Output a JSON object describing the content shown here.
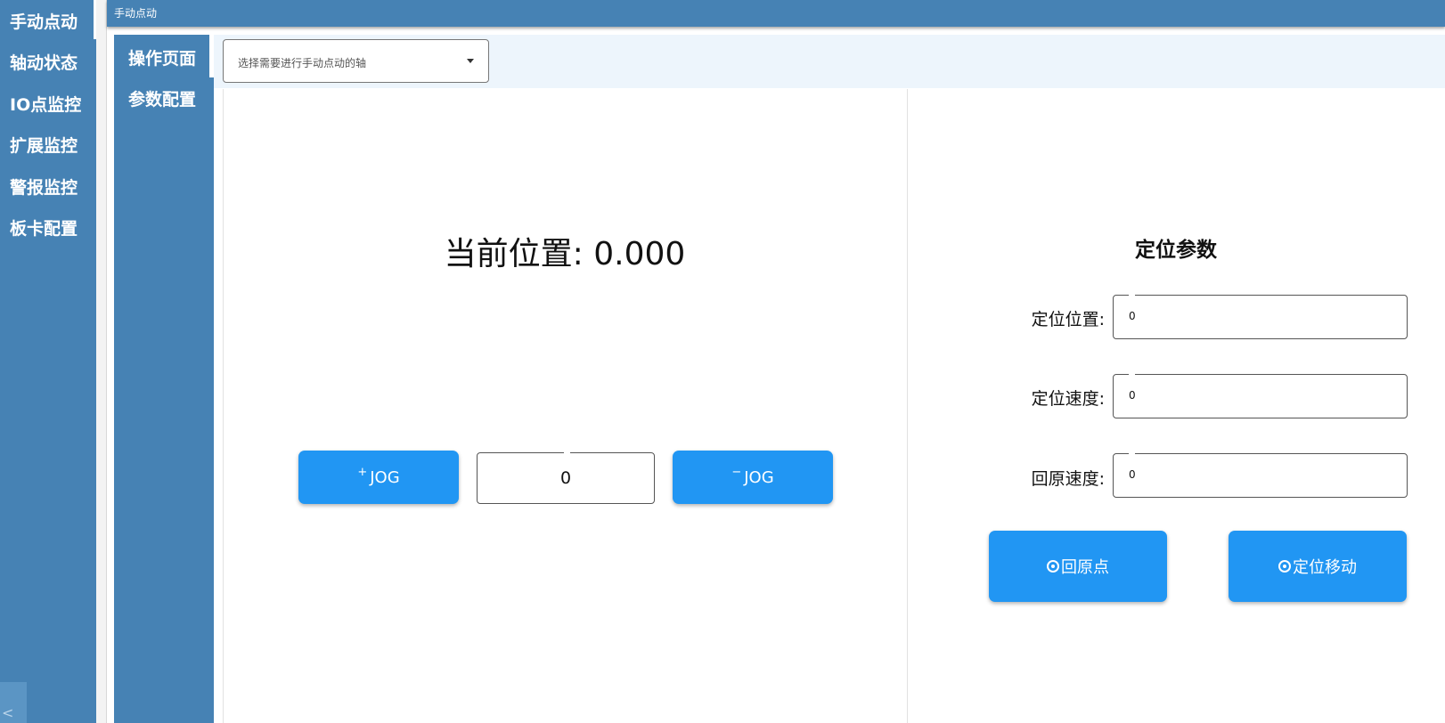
{
  "nav": {
    "items": [
      {
        "label": "手动点动"
      },
      {
        "label": "轴动状态"
      },
      {
        "label": "IO点监控"
      },
      {
        "label": "扩展监控"
      },
      {
        "label": "警报监控"
      },
      {
        "label": "板卡配置"
      }
    ],
    "collapse_symbol": "<"
  },
  "topbar": {
    "title": "手动点动"
  },
  "subnav": {
    "items": [
      {
        "label": "操作页面"
      },
      {
        "label": "参数配置"
      }
    ]
  },
  "axis_select": {
    "placeholder": "选择需要进行手动点动的轴"
  },
  "jog": {
    "current_position_label": "当前位置: 0.000",
    "plus_sign": "+",
    "minus_sign": "−",
    "button_text": "JOG",
    "value": "0"
  },
  "params": {
    "title": "定位参数",
    "fields": [
      {
        "label": "定位位置:",
        "value": "0"
      },
      {
        "label": "定位速度:",
        "value": "0"
      },
      {
        "label": "回原速度:",
        "value": "0"
      }
    ],
    "home_button": "回原点",
    "move_button": "定位移动"
  },
  "colors": {
    "nav_bg": "#4682b4",
    "button_blue": "#2196f3",
    "select_row_bg": "#edf5fc"
  }
}
